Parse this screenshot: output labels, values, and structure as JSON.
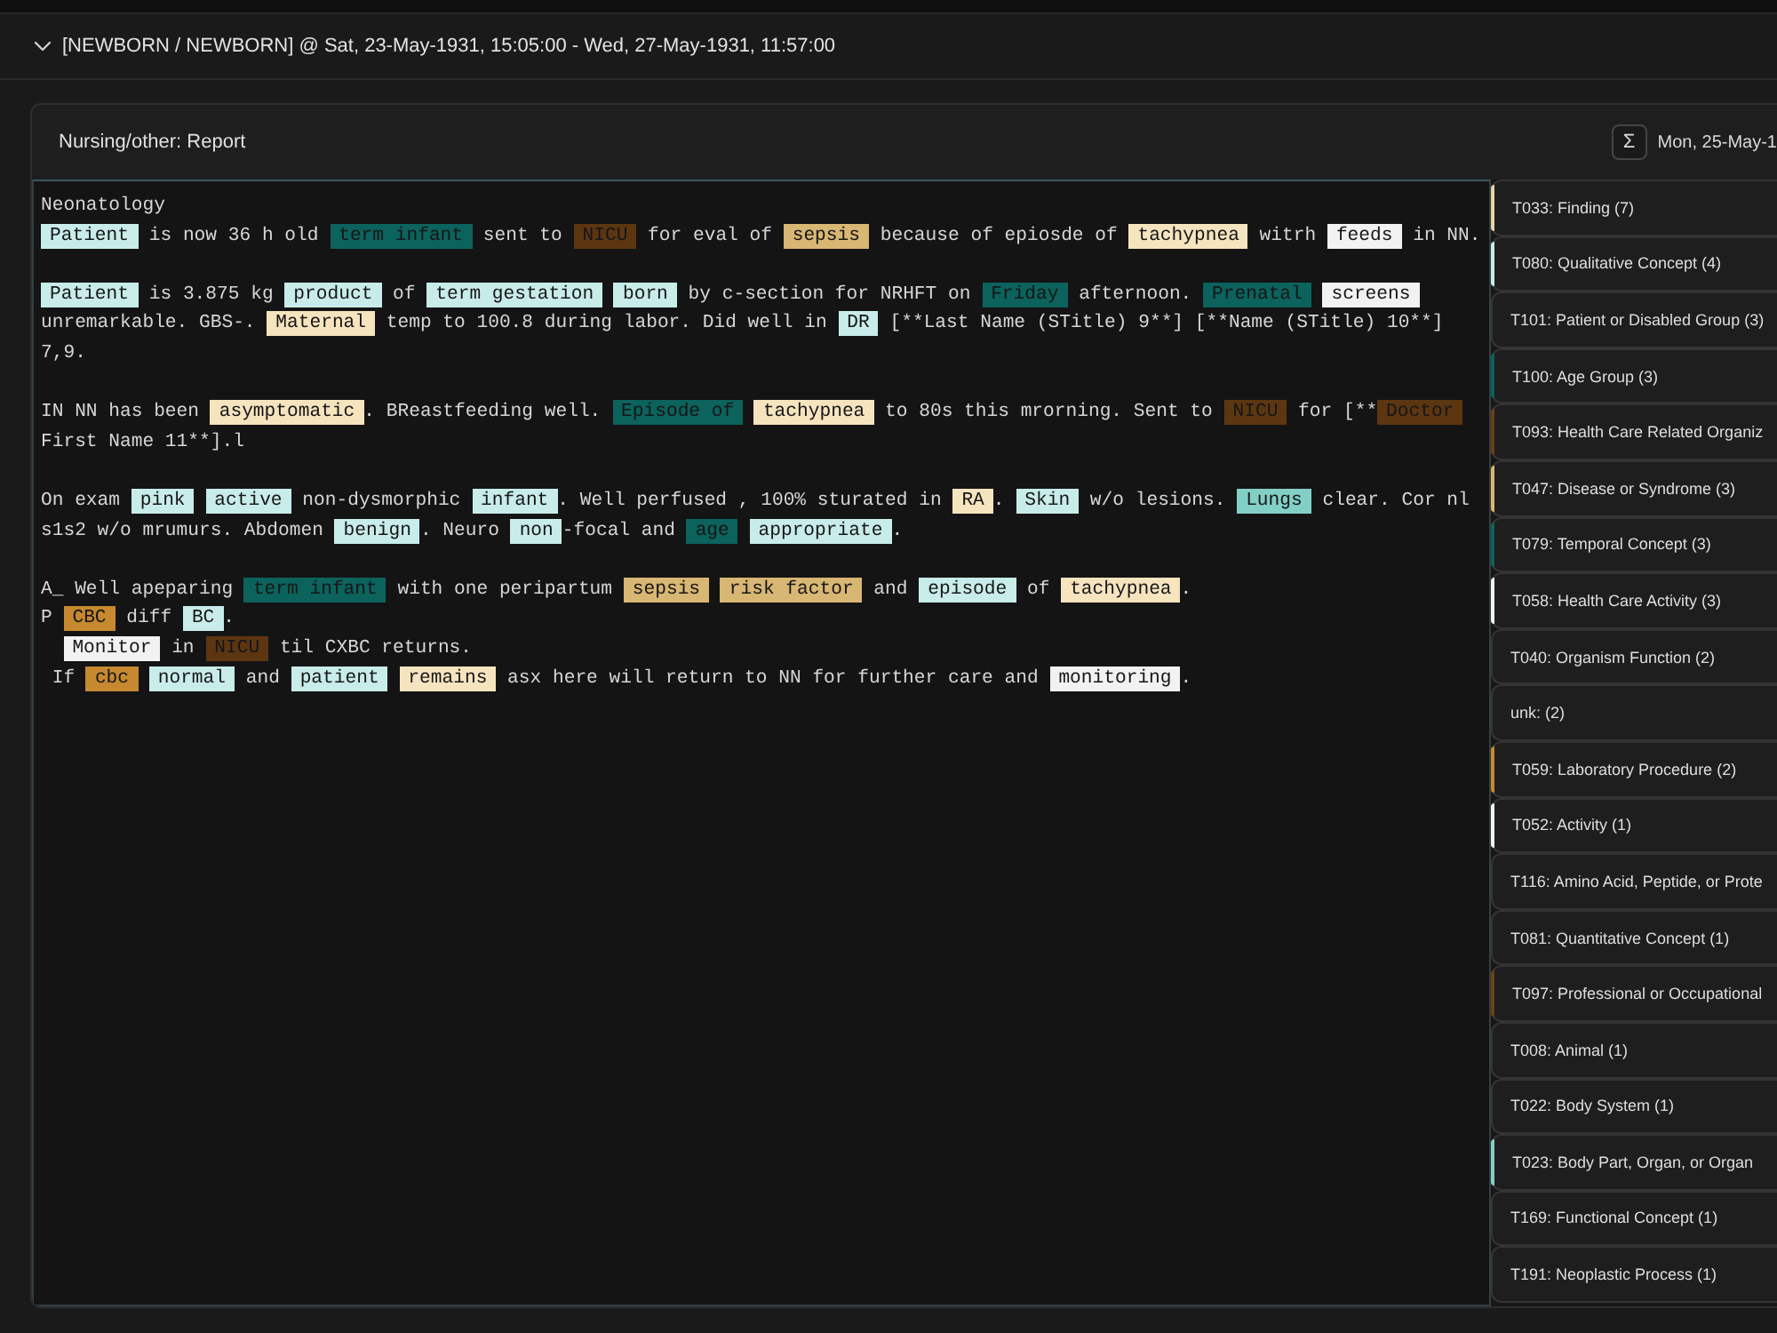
{
  "header": {
    "title": "[NEWBORN / NEWBORN] @ Sat, 23-May-1931, 15:05:00 - Wed, 27-May-1931, 11:57:00",
    "expanded": true
  },
  "report": {
    "title": "Nursing/other: Report",
    "sum_button": "Σ",
    "date": "Mon, 25-May-1"
  },
  "note": {
    "paragraphs": [
      {
        "lines": [
          {
            "indented": false,
            "segments": [
              {
                "kind": "text",
                "text": "Neonatology"
              }
            ]
          },
          {
            "indented": false,
            "segments": [
              {
                "kind": "tag",
                "text": "Patient",
                "color": "#c8ecea"
              },
              {
                "kind": "text",
                "text": " is now 36 h old "
              },
              {
                "kind": "tag",
                "text": "term infant",
                "color": "#0c625c"
              },
              {
                "kind": "text",
                "text": " sent to "
              },
              {
                "kind": "tag",
                "text": "NICU",
                "color": "#5c3611"
              },
              {
                "kind": "text",
                "text": " for eval of "
              },
              {
                "kind": "tag",
                "text": "sepsis",
                "color": "#d8b673"
              },
              {
                "kind": "text",
                "text": " because of epiosde of "
              },
              {
                "kind": "tag",
                "text": "tachypnea",
                "color": "#f6e4bf"
              },
              {
                "kind": "text",
                "text": " witrh "
              },
              {
                "kind": "tag",
                "text": "feeds",
                "color": "#f2f2f2"
              },
              {
                "kind": "text",
                "text": " in NN."
              }
            ]
          }
        ]
      },
      {
        "lines": [
          {
            "indented": false,
            "segments": [
              {
                "kind": "tag",
                "text": "Patient",
                "color": "#c8ecea"
              },
              {
                "kind": "text",
                "text": " is 3.875 kg "
              },
              {
                "kind": "tag",
                "text": "product",
                "color": "#c8ecea"
              },
              {
                "kind": "text",
                "text": " of "
              },
              {
                "kind": "tag",
                "text": "term gestation",
                "color": "#c8ecea"
              },
              {
                "kind": "tag",
                "text": "born",
                "color": "#c8ecea"
              },
              {
                "kind": "text",
                "text": " by c-section for NRHFT on "
              },
              {
                "kind": "tag",
                "text": "Friday",
                "color": "#0c625c"
              },
              {
                "kind": "text",
                "text": " afternoon. "
              },
              {
                "kind": "tag",
                "text": "Prenatal",
                "color": "#0c625c"
              },
              {
                "kind": "tag",
                "text": "screens",
                "color": "#f2f2f2"
              }
            ]
          },
          {
            "indented": false,
            "segments": [
              {
                "kind": "text",
                "text": "unremarkable. GBS-. "
              },
              {
                "kind": "tag",
                "text": "Maternal",
                "color": "#f6e4bf"
              },
              {
                "kind": "text",
                "text": " temp to 100.8 during labor. Did well in "
              },
              {
                "kind": "tag",
                "text": "DR",
                "color": "#c8ecea"
              },
              {
                "kind": "text",
                "text": " [**Last Name (STitle) 9**] [**Name (STitle) 10**]"
              }
            ]
          },
          {
            "indented": false,
            "segments": [
              {
                "kind": "text",
                "text": "7,9."
              }
            ]
          }
        ]
      },
      {
        "lines": [
          {
            "indented": false,
            "segments": [
              {
                "kind": "text",
                "text": "IN NN has been "
              },
              {
                "kind": "tag",
                "text": "asymptomatic",
                "color": "#f6e4bf"
              },
              {
                "kind": "text",
                "text": ". BReastfeeding well. "
              },
              {
                "kind": "tag",
                "text": "Episode of",
                "color": "#0c625c"
              },
              {
                "kind": "tag",
                "text": "tachypnea",
                "color": "#f6e4bf"
              },
              {
                "kind": "text",
                "text": " to 80s this mrorning. Sent to "
              },
              {
                "kind": "tag",
                "text": "NICU",
                "color": "#5c3611"
              },
              {
                "kind": "text",
                "text": " for [**"
              },
              {
                "kind": "tag",
                "text": "Doctor",
                "color": "#5c3611"
              }
            ]
          },
          {
            "indented": false,
            "segments": [
              {
                "kind": "text",
                "text": "First Name 11**].l"
              }
            ]
          }
        ]
      },
      {
        "lines": [
          {
            "indented": false,
            "segments": [
              {
                "kind": "text",
                "text": "On exam "
              },
              {
                "kind": "tag",
                "text": "pink",
                "color": "#c8ecea"
              },
              {
                "kind": "tag",
                "text": "active",
                "color": "#c8ecea"
              },
              {
                "kind": "text",
                "text": " non-dysmorphic "
              },
              {
                "kind": "tag",
                "text": "infant",
                "color": "#c8ecea"
              },
              {
                "kind": "text",
                "text": ". Well perfused , 100% sturated in "
              },
              {
                "kind": "tag",
                "text": "RA",
                "color": "#f6e4bf"
              },
              {
                "kind": "text",
                "text": ". "
              },
              {
                "kind": "tag",
                "text": "Skin",
                "color": "#c8ecea"
              },
              {
                "kind": "text",
                "text": " w/o lesions. "
              },
              {
                "kind": "tag",
                "text": "Lungs",
                "color": "#82cfc5"
              },
              {
                "kind": "text",
                "text": " clear. Cor nl"
              }
            ]
          },
          {
            "indented": false,
            "segments": [
              {
                "kind": "text",
                "text": "s1s2 w/o mrumurs. Abdomen "
              },
              {
                "kind": "tag",
                "text": "benign",
                "color": "#c8ecea"
              },
              {
                "kind": "text",
                "text": ". Neuro "
              },
              {
                "kind": "tag",
                "text": "non",
                "color": "#c8ecea"
              },
              {
                "kind": "text",
                "text": "-focal and "
              },
              {
                "kind": "tag",
                "text": "age",
                "color": "#0c625c"
              },
              {
                "kind": "tag",
                "text": "appropriate",
                "color": "#c8ecea"
              },
              {
                "kind": "text",
                "text": "."
              }
            ]
          }
        ]
      },
      {
        "lines": [
          {
            "indented": false,
            "segments": [
              {
                "kind": "text",
                "text": "A_ Well apeparing "
              },
              {
                "kind": "tag",
                "text": "term infant",
                "color": "#0c625c"
              },
              {
                "kind": "text",
                "text": " with one peripartum "
              },
              {
                "kind": "tag",
                "text": "sepsis",
                "color": "#d8b673"
              },
              {
                "kind": "tag",
                "text": "risk factor",
                "color": "#d8b673"
              },
              {
                "kind": "text",
                "text": " and "
              },
              {
                "kind": "tag",
                "text": "episode",
                "color": "#c8ecea"
              },
              {
                "kind": "text",
                "text": " of "
              },
              {
                "kind": "tag",
                "text": "tachypnea",
                "color": "#f6e4bf"
              },
              {
                "kind": "text",
                "text": "."
              }
            ]
          },
          {
            "indented": false,
            "segments": [
              {
                "kind": "text",
                "text": "P "
              },
              {
                "kind": "tag",
                "text": "CBC",
                "color": "#c6892f"
              },
              {
                "kind": "text",
                "text": " diff "
              },
              {
                "kind": "tag",
                "text": "BC",
                "color": "#c8ecea"
              },
              {
                "kind": "text",
                "text": "."
              }
            ]
          },
          {
            "indented": true,
            "segments": [
              {
                "kind": "tag",
                "text": "Monitor",
                "color": "#f2f2f2"
              },
              {
                "kind": "text",
                "text": " in "
              },
              {
                "kind": "tag",
                "text": "NICU",
                "color": "#5c3611"
              },
              {
                "kind": "text",
                "text": " til CXBC returns."
              }
            ]
          },
          {
            "indented": false,
            "segments": [
              {
                "kind": "text",
                "text": " If "
              },
              {
                "kind": "tag",
                "text": "cbc",
                "color": "#c6892f"
              },
              {
                "kind": "tag",
                "text": "normal",
                "color": "#c8ecea"
              },
              {
                "kind": "text",
                "text": " and "
              },
              {
                "kind": "tag",
                "text": "patient",
                "color": "#c8ecea"
              },
              {
                "kind": "tag",
                "text": "remains",
                "color": "#f6e4bf"
              },
              {
                "kind": "text",
                "text": " asx here will return to NN for further care and "
              },
              {
                "kind": "tag",
                "text": "monitoring",
                "color": "#f2f2f2"
              },
              {
                "kind": "text",
                "text": "."
              }
            ]
          }
        ]
      }
    ]
  },
  "sidebar": {
    "items": [
      {
        "label": "T033: Finding (7)",
        "color": "#e8d3a4"
      },
      {
        "label": "T080: Qualitative Concept (4)",
        "color": "#c8ecea"
      },
      {
        "label": "T101: Patient or Disabled Group (3)"
      },
      {
        "label": "T100: Age Group (3)",
        "color": "#0c625c"
      },
      {
        "label": "T093: Health Care Related Organiz",
        "color": "#6b3f12"
      },
      {
        "label": "T047: Disease or Syndrome (3)",
        "color": "#d8b673"
      },
      {
        "label": "T079: Temporal Concept (3)",
        "color": "#0c625c"
      },
      {
        "label": "T058: Health Care Activity (3)",
        "color": "#f2f2f2"
      },
      {
        "label": "T040: Organism Function (2)"
      },
      {
        "label": "unk: (2)"
      },
      {
        "label": "T059: Laboratory Procedure (2)",
        "color": "#c6892f"
      },
      {
        "label": "T052: Activity (1)",
        "color": "#f2f2f2"
      },
      {
        "label": "T116: Amino Acid, Peptide, or Prote"
      },
      {
        "label": "T081: Quantitative Concept (1)"
      },
      {
        "label": "T097: Professional or Occupational",
        "color": "#6b4015"
      },
      {
        "label": "T008: Animal (1)"
      },
      {
        "label": "T022: Body System (1)"
      },
      {
        "label": "T023: Body Part, Organ, or Organ",
        "color": "#82cfc5"
      },
      {
        "label": "T169: Functional Concept (1)"
      },
      {
        "label": "T191: Neoplastic Process (1)"
      }
    ]
  }
}
